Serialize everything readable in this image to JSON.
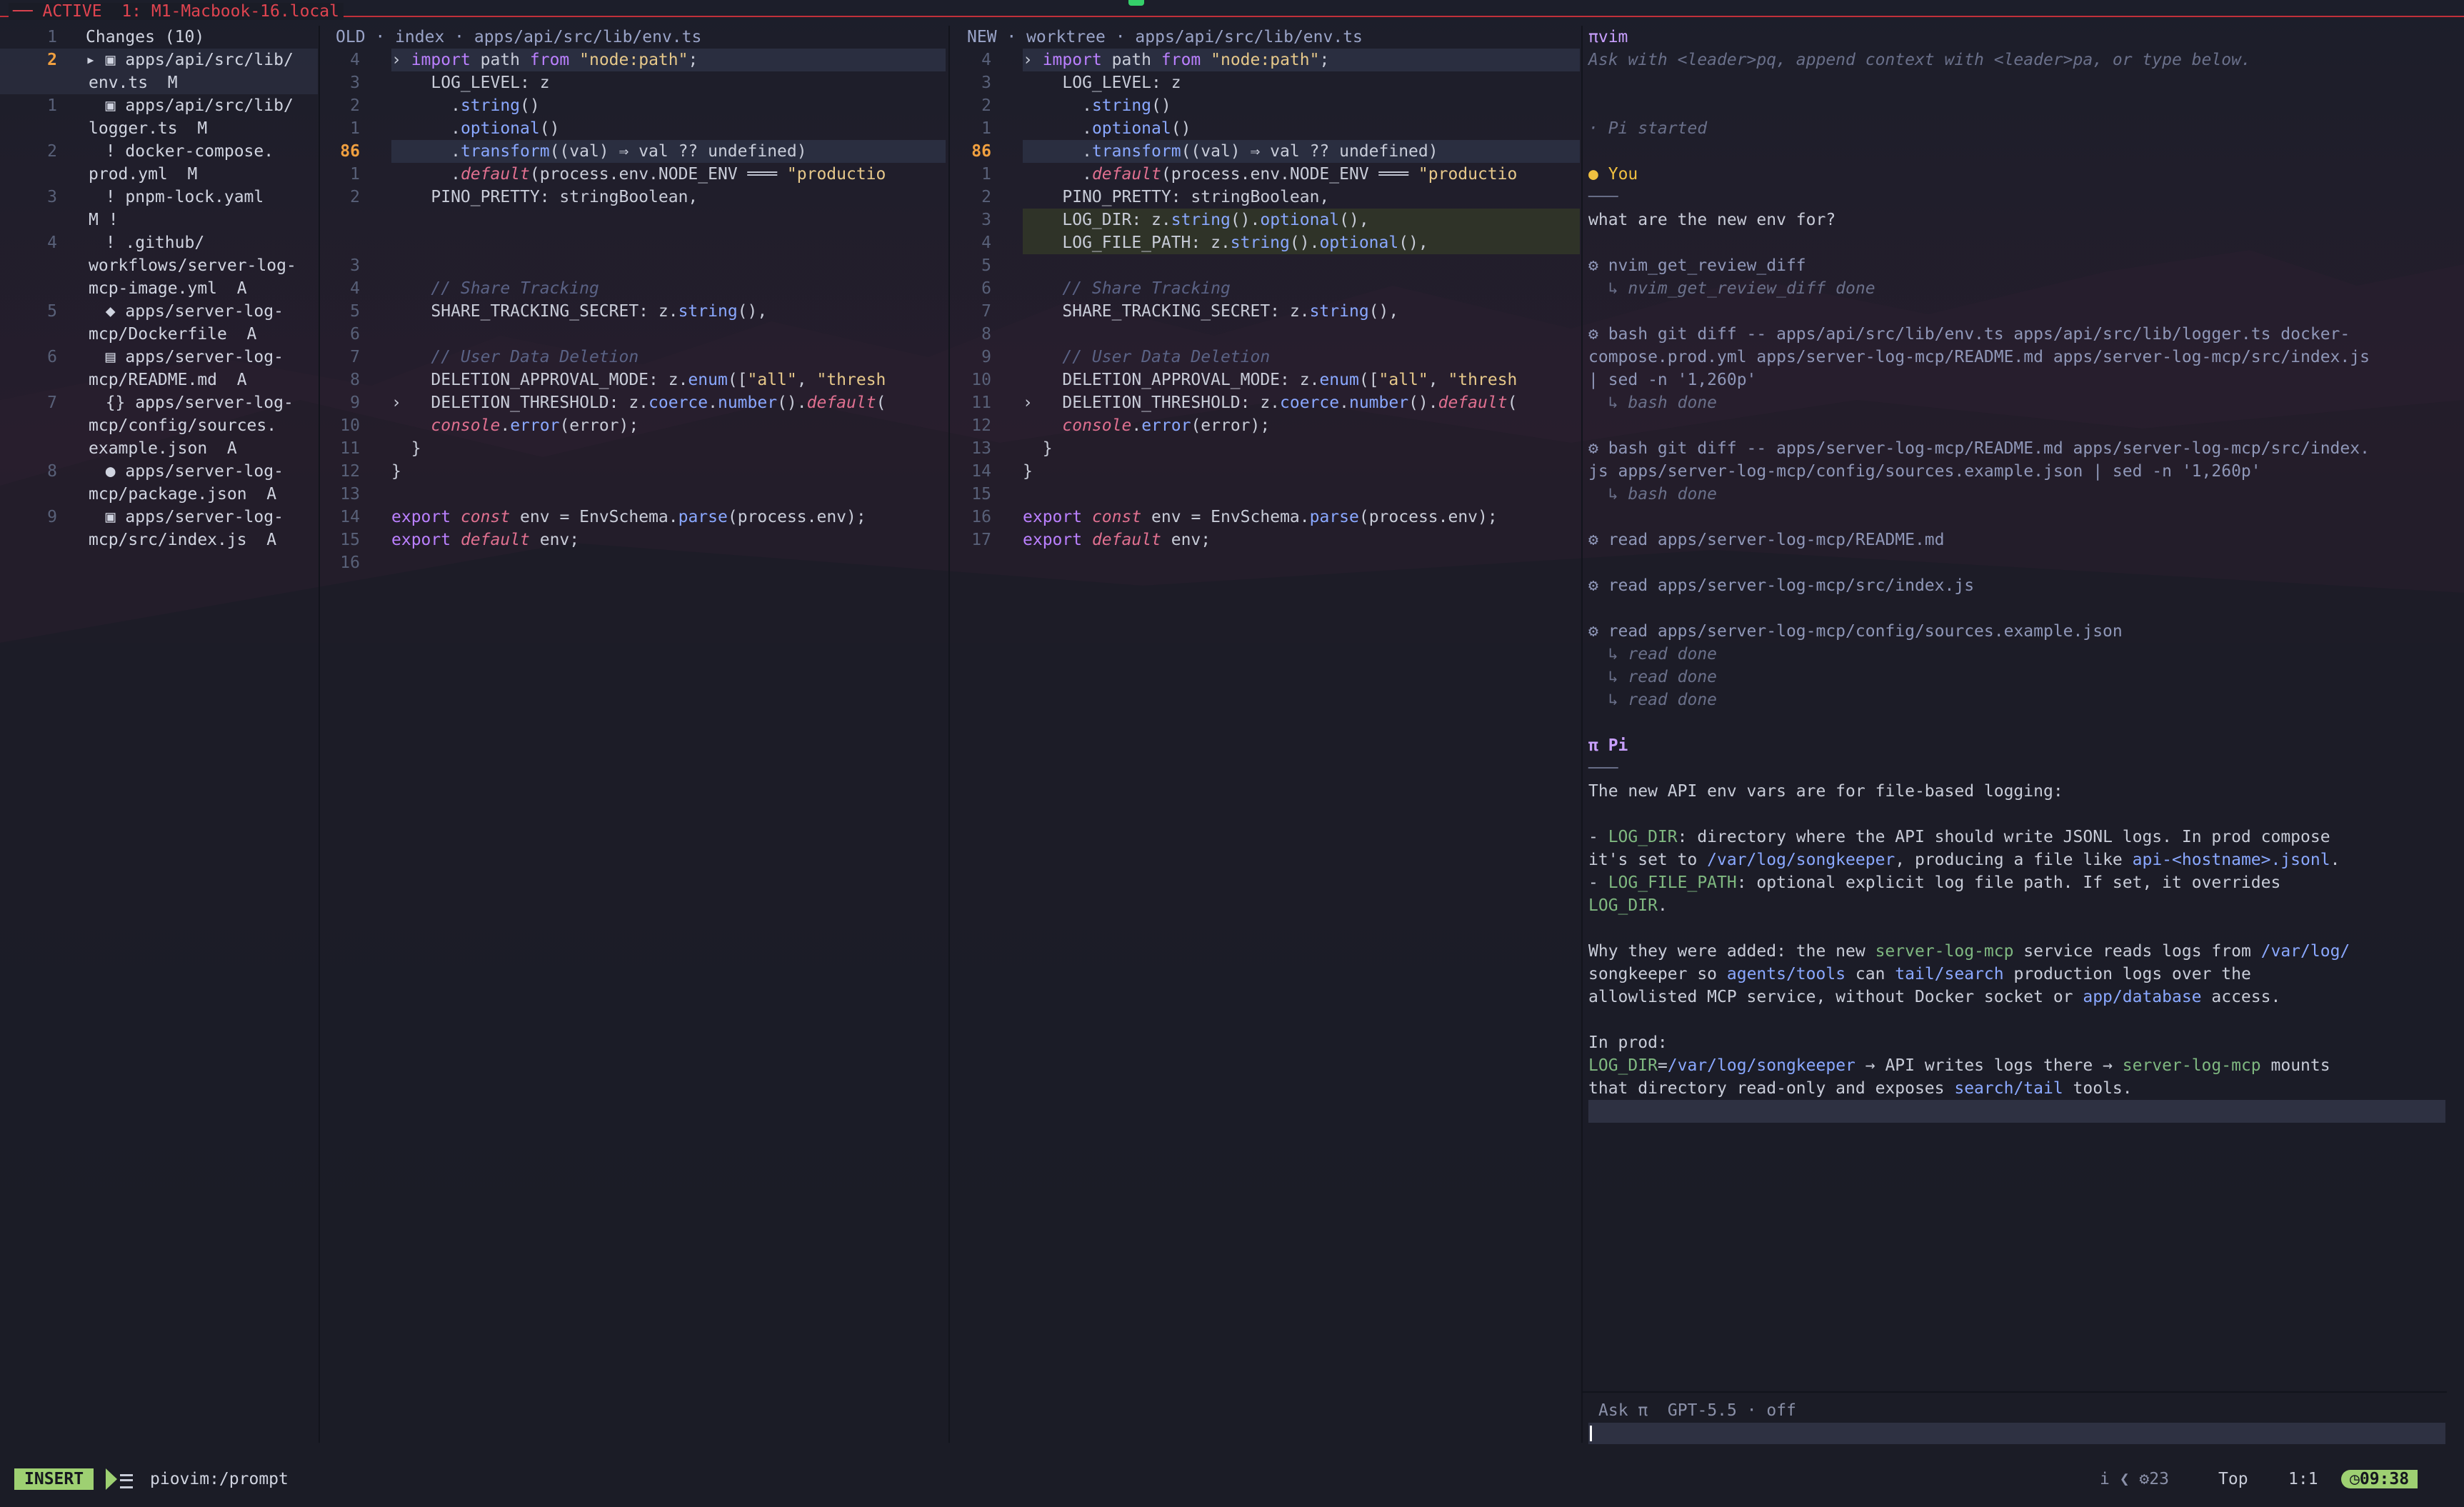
{
  "topbar": {
    "label": "── ACTIVE  1: M1-Macbook-16.local"
  },
  "tree": {
    "header": "Changes (10)",
    "items": [
      {
        "ln": "2",
        "cur": true,
        "lines": [
          "▸ ▣ apps/api/src/lib/",
          "env.ts  M"
        ],
        "icon": "typescript-file-icon"
      },
      {
        "ln": "1",
        "lines": [
          "  ▣ apps/api/src/lib/",
          "logger.ts  M"
        ],
        "icon": "typescript-file-icon"
      },
      {
        "ln": "2",
        "lines": [
          "  ! docker-compose.",
          "prod.yml  M"
        ],
        "icon": "warning-icon"
      },
      {
        "ln": "3",
        "lines": [
          "  ! pnpm-lock.yaml",
          "M !"
        ],
        "icon": "warning-icon"
      },
      {
        "ln": "4",
        "lines": [
          "  ! .github/",
          "workflows/server-log-",
          "mcp-image.yml  A"
        ],
        "icon": "warning-icon"
      },
      {
        "ln": "5",
        "lines": [
          "  ◆ apps/server-log-",
          "mcp/Dockerfile  A"
        ],
        "icon": "docker-icon"
      },
      {
        "ln": "6",
        "lines": [
          "  ▤ apps/server-log-",
          "mcp/README.md  A"
        ],
        "icon": "markdown-icon"
      },
      {
        "ln": "7",
        "lines": [
          "  {} apps/server-log-",
          "mcp/config/sources.",
          "example.json  A"
        ],
        "icon": "json-icon"
      },
      {
        "ln": "8",
        "lines": [
          "  ● apps/server-log-",
          "mcp/package.json  A"
        ],
        "icon": "node-icon"
      },
      {
        "ln": "9",
        "lines": [
          "  ▣ apps/server-log-",
          "mcp/src/index.js  A"
        ],
        "icon": "javascript-file-icon"
      }
    ]
  },
  "old": {
    "title": "OLD · index · apps/api/src/lib/env.ts",
    "rows": [
      {
        "ln": "4",
        "code": "› import path from \"node:path\";",
        "hl": "cur"
      },
      {
        "ln": "3",
        "code": "    LOG_LEVEL: z"
      },
      {
        "ln": "2",
        "code": "      .string()"
      },
      {
        "ln": "1",
        "code": "      .optional()"
      },
      {
        "ln": "86",
        "code": "      .transform((val) ⇒ val ?? undefined)",
        "hl": "cur",
        "lnhl": true
      },
      {
        "ln": "1",
        "code": "      .default(process.env.NODE_ENV ═══ \"productio"
      },
      {
        "ln": "2",
        "code": "    PINO_PRETTY: stringBoolean,"
      },
      {
        "ln": "",
        "code": ""
      },
      {
        "ln": "",
        "code": ""
      },
      {
        "ln": "3",
        "code": ""
      },
      {
        "ln": "4",
        "code": "    // Share Tracking",
        "cm": true
      },
      {
        "ln": "5",
        "code": "    SHARE_TRACKING_SECRET: z.string(),"
      },
      {
        "ln": "6",
        "code": ""
      },
      {
        "ln": "7",
        "code": "    // User Data Deletion",
        "cm": true
      },
      {
        "ln": "8",
        "code": "    DELETION_APPROVAL_MODE: z.enum([\"all\", \"thresh"
      },
      {
        "ln": "9",
        "code": "›   DELETION_THRESHOLD: z.coerce.number().default("
      },
      {
        "ln": "10",
        "code": "    console.error(error);"
      },
      {
        "ln": "11",
        "code": "  }"
      },
      {
        "ln": "12",
        "code": "}"
      },
      {
        "ln": "13",
        "code": ""
      },
      {
        "ln": "14",
        "code": "export const env = EnvSchema.parse(process.env);"
      },
      {
        "ln": "15",
        "code": "export default env;"
      },
      {
        "ln": "16",
        "code": "",
        "hl": "add"
      }
    ]
  },
  "new": {
    "title": "NEW · worktree · apps/api/src/lib/env.ts",
    "rows": [
      {
        "ln": "4",
        "code": "› import path from \"node:path\";",
        "hl": "cur"
      },
      {
        "ln": "3",
        "code": "    LOG_LEVEL: z"
      },
      {
        "ln": "2",
        "code": "      .string()"
      },
      {
        "ln": "1",
        "code": "      .optional()"
      },
      {
        "ln": "86",
        "code": "      .transform((val) ⇒ val ?? undefined)",
        "hl": "cur",
        "lnhl": true
      },
      {
        "ln": "1",
        "code": "      .default(process.env.NODE_ENV ═══ \"productio"
      },
      {
        "ln": "2",
        "code": "    PINO_PRETTY: stringBoolean,"
      },
      {
        "ln": "3",
        "code": "    LOG_DIR: z.string().optional(),",
        "hl": "add"
      },
      {
        "ln": "4",
        "code": "    LOG_FILE_PATH: z.string().optional(),",
        "hl": "add"
      },
      {
        "ln": "5",
        "code": ""
      },
      {
        "ln": "6",
        "code": "    // Share Tracking",
        "cm": true
      },
      {
        "ln": "7",
        "code": "    SHARE_TRACKING_SECRET: z.string(),"
      },
      {
        "ln": "8",
        "code": ""
      },
      {
        "ln": "9",
        "code": "    // User Data Deletion",
        "cm": true
      },
      {
        "ln": "10",
        "code": "    DELETION_APPROVAL_MODE: z.enum([\"all\", \"thresh"
      },
      {
        "ln": "11",
        "code": "›   DELETION_THRESHOLD: z.coerce.number().default("
      },
      {
        "ln": "12",
        "code": "    console.error(error);"
      },
      {
        "ln": "13",
        "code": "  }"
      },
      {
        "ln": "14",
        "code": "}"
      },
      {
        "ln": "15",
        "code": ""
      },
      {
        "ln": "16",
        "code": "export const env = EnvSchema.parse(process.env);"
      },
      {
        "ln": "17",
        "code": "export default env;"
      }
    ]
  },
  "pi": {
    "title": "πvim",
    "hint": "Ask with <leader>pq, append context with <leader>pa, or type below.",
    "lines": [
      {
        "t": "",
        "c": ""
      },
      {
        "t": "",
        "c": ""
      },
      {
        "t": "· Pi started",
        "c": "muted"
      },
      {
        "t": "",
        "c": ""
      },
      {
        "t": "● You",
        "c": "you"
      },
      {
        "t": "───",
        "c": "muted"
      },
      {
        "t": "what are the new env for?",
        "c": ""
      },
      {
        "t": "",
        "c": ""
      },
      {
        "t": "⚙ nvim_get_review_diff",
        "c": "tool"
      },
      {
        "t": "  ↳ nvim_get_review_diff done",
        "c": "ok"
      },
      {
        "t": "",
        "c": ""
      },
      {
        "t": "⚙ bash git diff -- apps/api/src/lib/env.ts apps/api/src/lib/logger.ts docker-",
        "c": "tool"
      },
      {
        "t": "compose.prod.yml apps/server-log-mcp/README.md apps/server-log-mcp/src/index.js",
        "c": "tool"
      },
      {
        "t": "| sed -n '1,260p'",
        "c": "tool"
      },
      {
        "t": "  ↳ bash done",
        "c": "ok"
      },
      {
        "t": "",
        "c": ""
      },
      {
        "t": "⚙ bash git diff -- apps/server-log-mcp/README.md apps/server-log-mcp/src/index.",
        "c": "tool"
      },
      {
        "t": "js apps/server-log-mcp/config/sources.example.json | sed -n '1,260p'",
        "c": "tool"
      },
      {
        "t": "  ↳ bash done",
        "c": "ok"
      },
      {
        "t": "",
        "c": ""
      },
      {
        "t": "⚙ read apps/server-log-mcp/README.md",
        "c": "tool"
      },
      {
        "t": "",
        "c": ""
      },
      {
        "t": "⚙ read apps/server-log-mcp/src/index.js",
        "c": "tool"
      },
      {
        "t": "",
        "c": ""
      },
      {
        "t": "⚙ read apps/server-log-mcp/config/sources.example.json",
        "c": "tool"
      },
      {
        "t": "  ↳ read done",
        "c": "ok"
      },
      {
        "t": "  ↳ read done",
        "c": "ok"
      },
      {
        "t": "  ↳ read done",
        "c": "ok"
      },
      {
        "t": "",
        "c": ""
      },
      {
        "t": "π Pi",
        "c": "hd"
      },
      {
        "t": "───",
        "c": "muted"
      },
      {
        "t": "The new API env vars are for file-based logging:",
        "c": ""
      },
      {
        "t": "",
        "c": ""
      },
      {
        "t": "- LOG_DIR: directory where the API should write JSONL logs. In prod compose",
        "c": ""
      },
      {
        "t": "it's set to /var/log/songkeeper, producing a file like api-<hostname>.jsonl.",
        "c": ""
      },
      {
        "t": "- LOG_FILE_PATH: optional explicit log file path. If set, it overrides",
        "c": ""
      },
      {
        "t": "LOG_DIR.",
        "c": ""
      },
      {
        "t": "",
        "c": ""
      },
      {
        "t": "Why they were added: the new server-log-mcp service reads logs from /var/log/",
        "c": ""
      },
      {
        "t": "songkeeper so agents/tools can tail/search production logs over the",
        "c": ""
      },
      {
        "t": "allowlisted MCP service, without Docker socket or app/database access.",
        "c": ""
      },
      {
        "t": "",
        "c": ""
      },
      {
        "t": "In prod:",
        "c": ""
      },
      {
        "t": "LOG_DIR=/var/log/songkeeper → API writes logs there → server-log-mcp mounts",
        "c": ""
      },
      {
        "t": "that directory read-only and exposes search/tail tools.",
        "c": ""
      }
    ],
    "prompt_label": "Ask π  GPT-5.5 · off"
  },
  "status": {
    "mode": "INSERT",
    "file": "piovim:/prompt",
    "diag": "i ❮ ⚙23",
    "pos": "Top",
    "cursor": "1:1",
    "clock": "◷09:38"
  }
}
